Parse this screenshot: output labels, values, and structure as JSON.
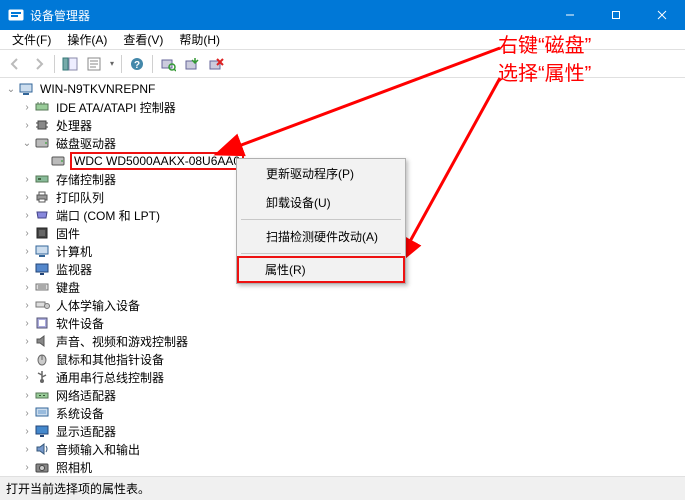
{
  "window": {
    "title": "设备管理器"
  },
  "menubar": {
    "file": "文件(F)",
    "action": "操作(A)",
    "view": "查看(V)",
    "help": "帮助(H)"
  },
  "tree": {
    "root": "WIN-N9TKVNREPNF",
    "ide": "IDE ATA/ATAPI 控制器",
    "cpu": "处理器",
    "disk_drives": "磁盘驱动器",
    "disk_item": "WDC WD5000AAKX-08U6AA0",
    "storage_ctrl": "存储控制器",
    "print_queue": "打印队列",
    "ports": "端口 (COM 和 LPT)",
    "firmware": "固件",
    "computer": "计算机",
    "monitor": "监视器",
    "keyboard": "键盘",
    "hid": "人体学输入设备",
    "software_dev": "软件设备",
    "sound_game": "声音、视频和游戏控制器",
    "mouse_ptr": "鼠标和其他指针设备",
    "usb": "通用串行总线控制器",
    "net": "网络适配器",
    "system_dev": "系统设备",
    "display": "显示适配器",
    "audio_io": "音频输入和输出",
    "camera": "照相机"
  },
  "context_menu": {
    "update_driver": "更新驱动程序(P)",
    "uninstall": "卸载设备(U)",
    "scan_changes": "扫描检测硬件改动(A)",
    "properties": "属性(R)"
  },
  "annotation": {
    "line1": "右键“磁盘”",
    "line2": "选择“属性”"
  },
  "status": {
    "text": "打开当前选择项的属性表。"
  }
}
